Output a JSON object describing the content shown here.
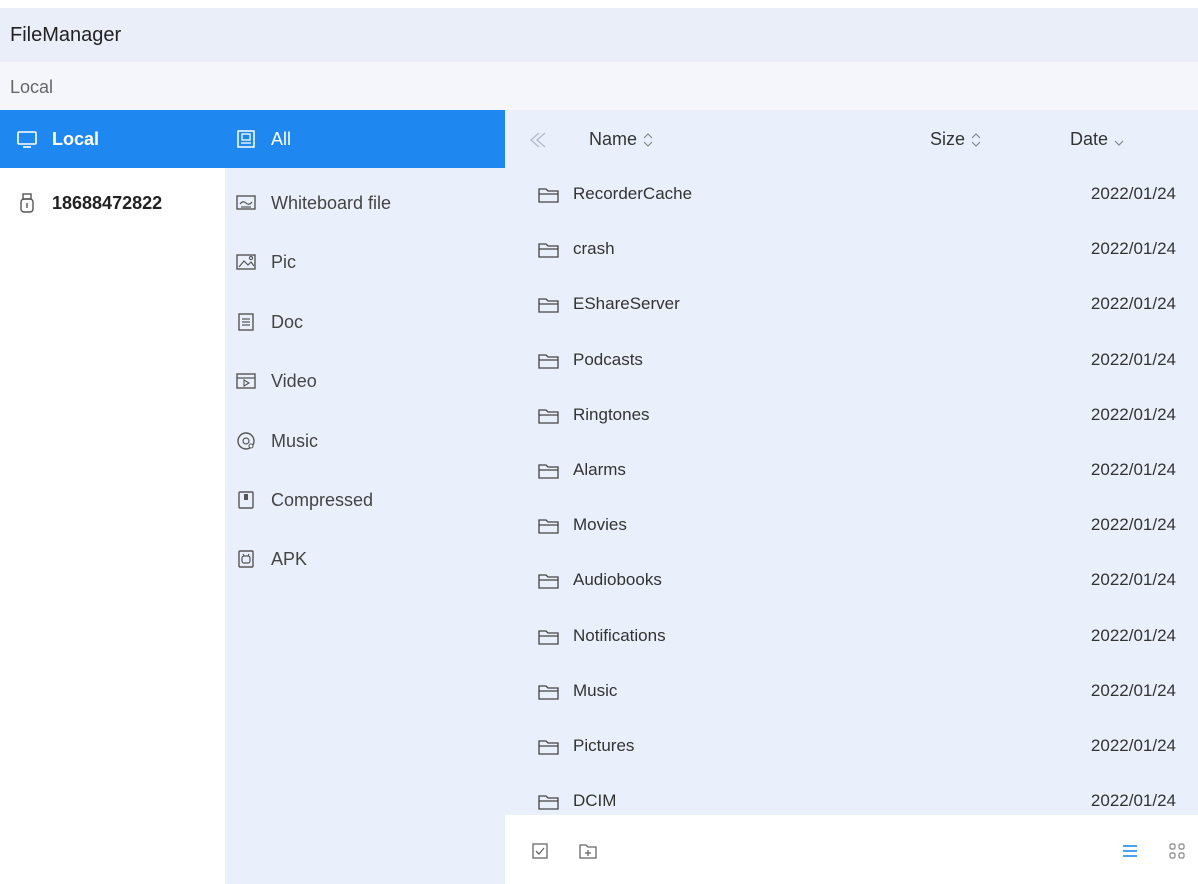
{
  "window": {
    "title": "FileManager"
  },
  "path": {
    "current": "Local"
  },
  "devices": [
    {
      "label": "Local",
      "icon": "monitor-icon",
      "selected": true
    },
    {
      "label": "18688472822",
      "icon": "usb-drive-icon",
      "selected": false
    }
  ],
  "categories": [
    {
      "label": "All",
      "icon": "all-files-icon",
      "selected": true
    },
    {
      "label": "Whiteboard file",
      "icon": "whiteboard-icon",
      "selected": false
    },
    {
      "label": "Pic",
      "icon": "picture-icon",
      "selected": false
    },
    {
      "label": "Doc",
      "icon": "document-icon",
      "selected": false
    },
    {
      "label": "Video",
      "icon": "video-icon",
      "selected": false
    },
    {
      "label": "Music",
      "icon": "music-icon",
      "selected": false
    },
    {
      "label": "Compressed",
      "icon": "archive-icon",
      "selected": false
    },
    {
      "label": "APK",
      "icon": "apk-icon",
      "selected": false
    }
  ],
  "file_list": {
    "columns": {
      "name": "Name",
      "size": "Size",
      "date": "Date"
    },
    "rows": [
      {
        "name": "RecorderCache",
        "size": "",
        "date": "2022/01/24"
      },
      {
        "name": "crash",
        "size": "",
        "date": "2022/01/24"
      },
      {
        "name": "EShareServer",
        "size": "",
        "date": "2022/01/24"
      },
      {
        "name": "Podcasts",
        "size": "",
        "date": "2022/01/24"
      },
      {
        "name": "Ringtones",
        "size": "",
        "date": "2022/01/24"
      },
      {
        "name": "Alarms",
        "size": "",
        "date": "2022/01/24"
      },
      {
        "name": "Movies",
        "size": "",
        "date": "2022/01/24"
      },
      {
        "name": "Audiobooks",
        "size": "",
        "date": "2022/01/24"
      },
      {
        "name": "Notifications",
        "size": "",
        "date": "2022/01/24"
      },
      {
        "name": "Music",
        "size": "",
        "date": "2022/01/24"
      },
      {
        "name": "Pictures",
        "size": "",
        "date": "2022/01/24"
      },
      {
        "name": "DCIM",
        "size": "",
        "date": "2022/01/24"
      }
    ]
  },
  "footer": {
    "select_icon": "checkbox-icon",
    "new_folder_icon": "new-folder-icon",
    "list_view_icon": "list-view-icon",
    "grid_view_icon": "grid-view-icon"
  },
  "colors": {
    "accent": "#1e88f0",
    "panel": "#e9f0fb"
  }
}
